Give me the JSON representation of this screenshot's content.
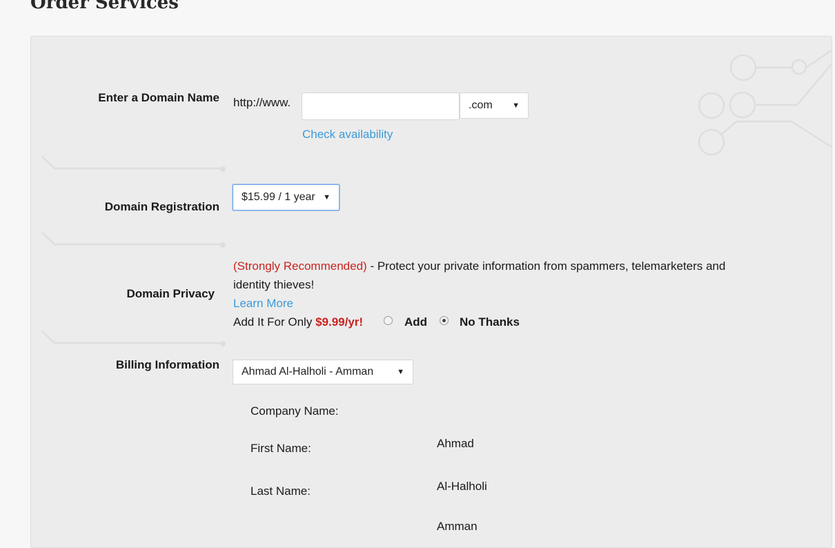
{
  "page_title": "Order Services",
  "domain_name": {
    "label": "Enter a Domain Name",
    "prefix": "http://www.",
    "value": "",
    "tld": ".com",
    "check_link": "Check availability"
  },
  "registration": {
    "label": "Domain Registration",
    "selected": "$15.99 / 1 year"
  },
  "privacy": {
    "label": "Domain Privacy",
    "recommended": "(Strongly Recommended)",
    "description_line1": "- Protect your private information from spammers, telemarketers and",
    "description_line2": "identity thieves!",
    "learn_more": "Learn More",
    "add_prefix": "Add It For Only",
    "price": "$9.99/yr!",
    "option_add": "Add",
    "option_no": "No Thanks",
    "selected": "No Thanks"
  },
  "billing": {
    "label": "Billing Information",
    "selected": "Ahmad Al-Halholi - Amman",
    "fields": [
      {
        "label": "Company Name:",
        "value": ""
      },
      {
        "label": "First Name:",
        "value": "Ahmad"
      },
      {
        "label": "Last Name:",
        "value": "Al-Halholi"
      },
      {
        "label": "",
        "value": "Amman"
      }
    ]
  },
  "colors": {
    "panel_bg": "#ececec",
    "link": "#3b9ad9",
    "accent_red": "#c9231f"
  }
}
